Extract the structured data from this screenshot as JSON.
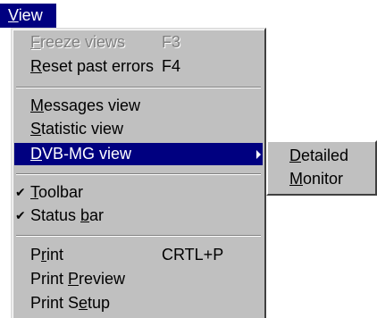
{
  "menubar": {
    "view": {
      "pre": "",
      "u": "V",
      "post": "iew"
    }
  },
  "menu": {
    "freeze": {
      "pre": "",
      "u": "F",
      "post": "reeze views",
      "shortcut": "F3"
    },
    "reset": {
      "pre": "",
      "u": "R",
      "post": "eset past errors",
      "shortcut": "F4"
    },
    "messages": {
      "pre": "",
      "u": "M",
      "post": "essages view"
    },
    "statistic": {
      "pre": "",
      "u": "S",
      "post": "tatistic view"
    },
    "dvb": {
      "pre": "",
      "u": "D",
      "post": "VB-MG view"
    },
    "toolbar": {
      "pre": "",
      "u": "T",
      "post": "oolbar",
      "check": "✔"
    },
    "statusbar": {
      "pre": "Status ",
      "u": "b",
      "post": "ar",
      "check": "✔"
    },
    "print": {
      "pre": "P",
      "u": "r",
      "post": "int",
      "shortcut": "CRTL+P"
    },
    "preview": {
      "pre": "Print ",
      "u": "P",
      "post": "review"
    },
    "setup": {
      "pre": "Print S",
      "u": "e",
      "post": "tup"
    }
  },
  "submenu": {
    "detailed": {
      "pre": "",
      "u": "D",
      "post": "etailed"
    },
    "monitor": {
      "pre": "",
      "u": "M",
      "post": "onitor"
    }
  }
}
